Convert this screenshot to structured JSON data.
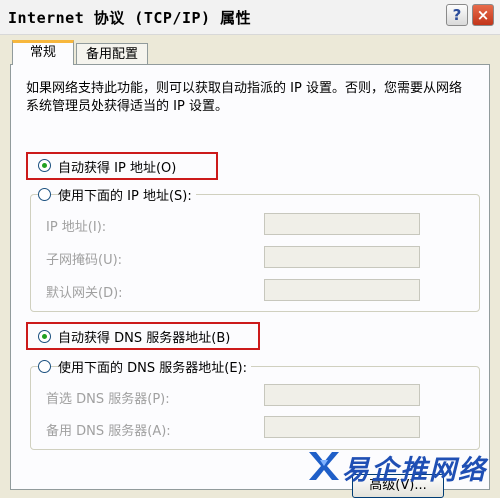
{
  "window": {
    "title": "Internet 协议 (TCP/IP) 属性",
    "help_label": "?",
    "close_label": "×"
  },
  "tabs": [
    {
      "label": "常规"
    },
    {
      "label": "备用配置"
    }
  ],
  "description": "如果网络支持此功能，则可以获取自动指派的 IP 设置。否则，您需要从网络系统管理员处获得适当的 IP 设置。",
  "ip": {
    "auto_label": "自动获得 IP 地址(O)",
    "manual_label": "使用下面的 IP 地址(S):",
    "auto_selected": true,
    "fields": [
      {
        "label": "IP 地址(I):"
      },
      {
        "label": "子网掩码(U):"
      },
      {
        "label": "默认网关(D):"
      }
    ]
  },
  "dns": {
    "auto_label": "自动获得 DNS 服务器地址(B)",
    "manual_label": "使用下面的 DNS 服务器地址(E):",
    "auto_selected": true,
    "fields": [
      {
        "label": "首选 DNS 服务器(P):"
      },
      {
        "label": "备用 DNS 服务器(A):"
      }
    ]
  },
  "buttons": {
    "advanced_label": "高级(V)..."
  },
  "watermark": {
    "text": "易企推网络"
  },
  "colors": {
    "highlight_border": "#cc1a1a",
    "selected_tab_accent": "#f7b73d",
    "radio_dot": "#21a121"
  }
}
